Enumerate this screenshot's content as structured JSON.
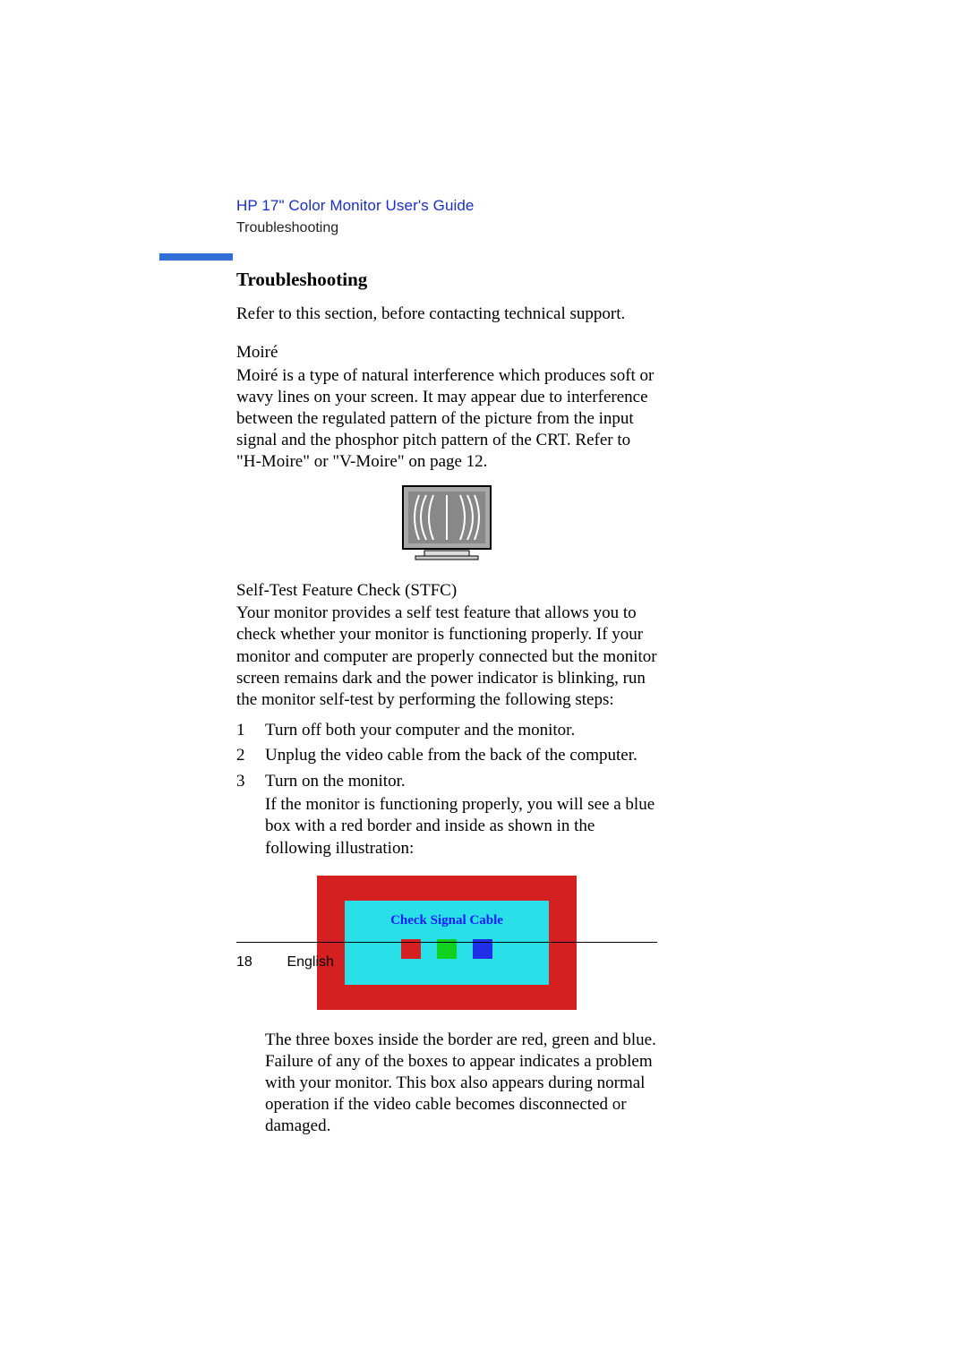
{
  "header": {
    "guide_title": "HP 17\" Color Monitor User's Guide",
    "breadcrumb": "Troubleshooting"
  },
  "section": {
    "title": "Troubleshooting",
    "intro": "Refer to this section, before contacting technical support."
  },
  "moire": {
    "heading": "Moiré",
    "body": "Moiré is a type of natural interference which produces soft or wavy lines on your screen. It may appear due to interference between the regulated pattern of the picture from the input signal and the phosphor pitch pattern of the CRT. Refer to  \"H-Moire\" or  \"V-Moire\" on page 12."
  },
  "stfc": {
    "heading": "Self-Test Feature Check (STFC)",
    "body": "Your monitor provides a self test feature that allows you to check whether your monitor is functioning properly. If your monitor and computer are properly connected but the monitor screen remains dark and the power indicator is blinking, run the monitor self-test by performing the following steps:",
    "steps": [
      {
        "n": "1",
        "text": "Turn off both your computer and the monitor."
      },
      {
        "n": "2",
        "text": "Unplug the video cable from the back of the computer."
      },
      {
        "n": "3",
        "text": "Turn on the monitor.",
        "sub": "If the monitor is functioning properly, you will see a blue box with a red border and inside as shown in the following illustration:"
      }
    ],
    "figure_label": "Check Signal Cable",
    "after": "The three boxes inside the border are red, green and blue. Failure of any of the boxes to appear indicates a problem with your monitor. This box also appears during normal operation if the video cable becomes disconnected or damaged."
  },
  "footer": {
    "page": "18",
    "lang": "English"
  },
  "colors": {
    "accent_blue": "#1a2ec8",
    "bar_blue": "#2f6fd6",
    "stfc_red": "#d42020",
    "stfc_cyan": "#29e0e8",
    "stfc_green": "#10d020",
    "stfc_blue_sq": "#2030e8"
  }
}
